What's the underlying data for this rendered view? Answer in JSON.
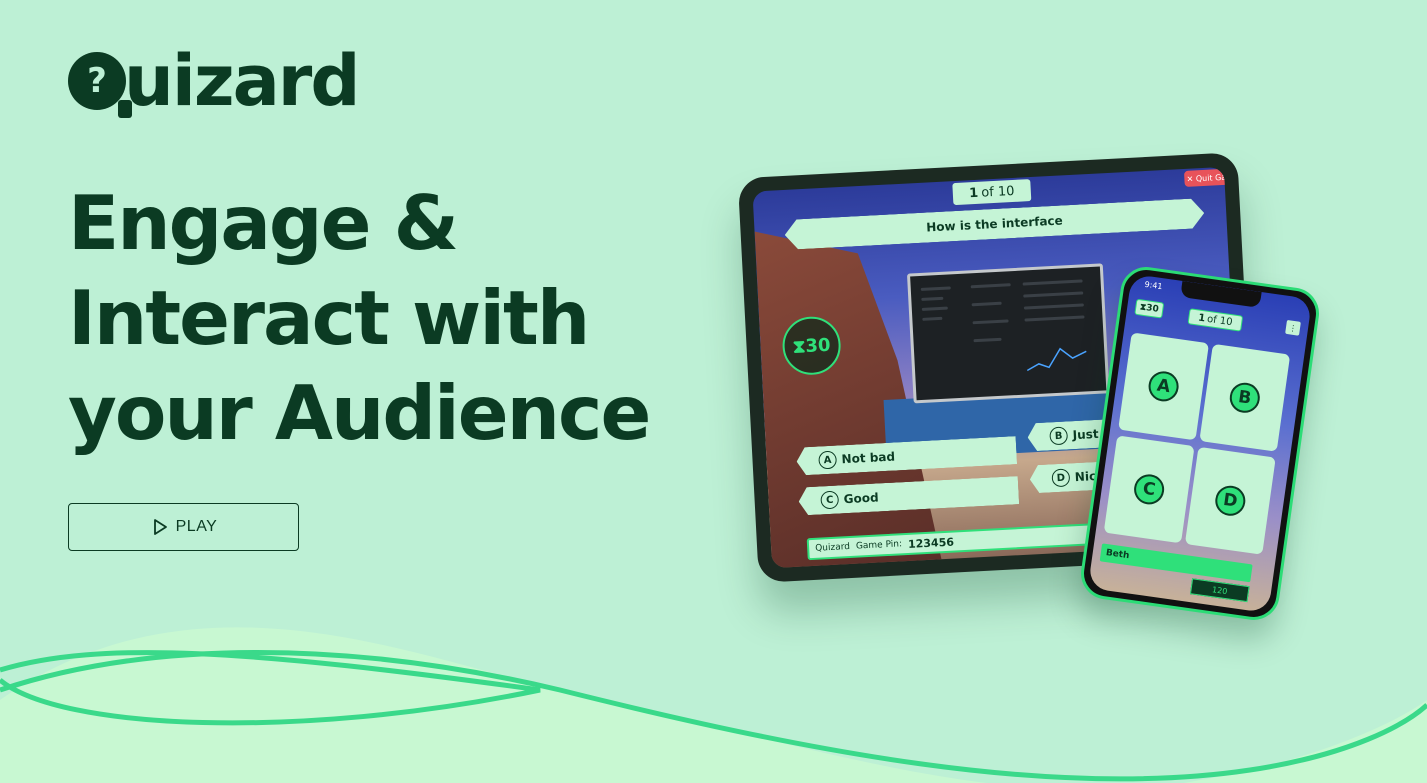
{
  "brand": {
    "logo_mark": "?",
    "name": "uizard"
  },
  "headline": [
    "Engage &",
    "Interact with",
    "your Audience"
  ],
  "play_button": {
    "label": "PLAY",
    "icon": "play-icon"
  },
  "tablet": {
    "counter_num": "1",
    "counter_rest": "of 10",
    "quit_label": "✕ Quit Ga",
    "question": "How is the interface",
    "timer": "30",
    "answers": [
      {
        "letter": "A",
        "text": "Not bad"
      },
      {
        "letter": "B",
        "text": "Just th"
      },
      {
        "letter": "C",
        "text": "Good"
      },
      {
        "letter": "D",
        "text": "Nic"
      }
    ],
    "brand_small": "Quizard",
    "pin_label": "Game Pin:",
    "pin_value": "123456"
  },
  "phone": {
    "time": "9:41",
    "timer": "30",
    "counter_num": "1",
    "counter_rest": "of 10",
    "menu": "⋮",
    "choices": [
      "A",
      "B",
      "C",
      "D"
    ],
    "player_name": "Beth",
    "player_score": "120"
  },
  "colors": {
    "background": "#bdf0d5",
    "primary_dark": "#0b3b23",
    "accent_green": "#2fe07a",
    "card_mint": "#c5f4d6"
  }
}
